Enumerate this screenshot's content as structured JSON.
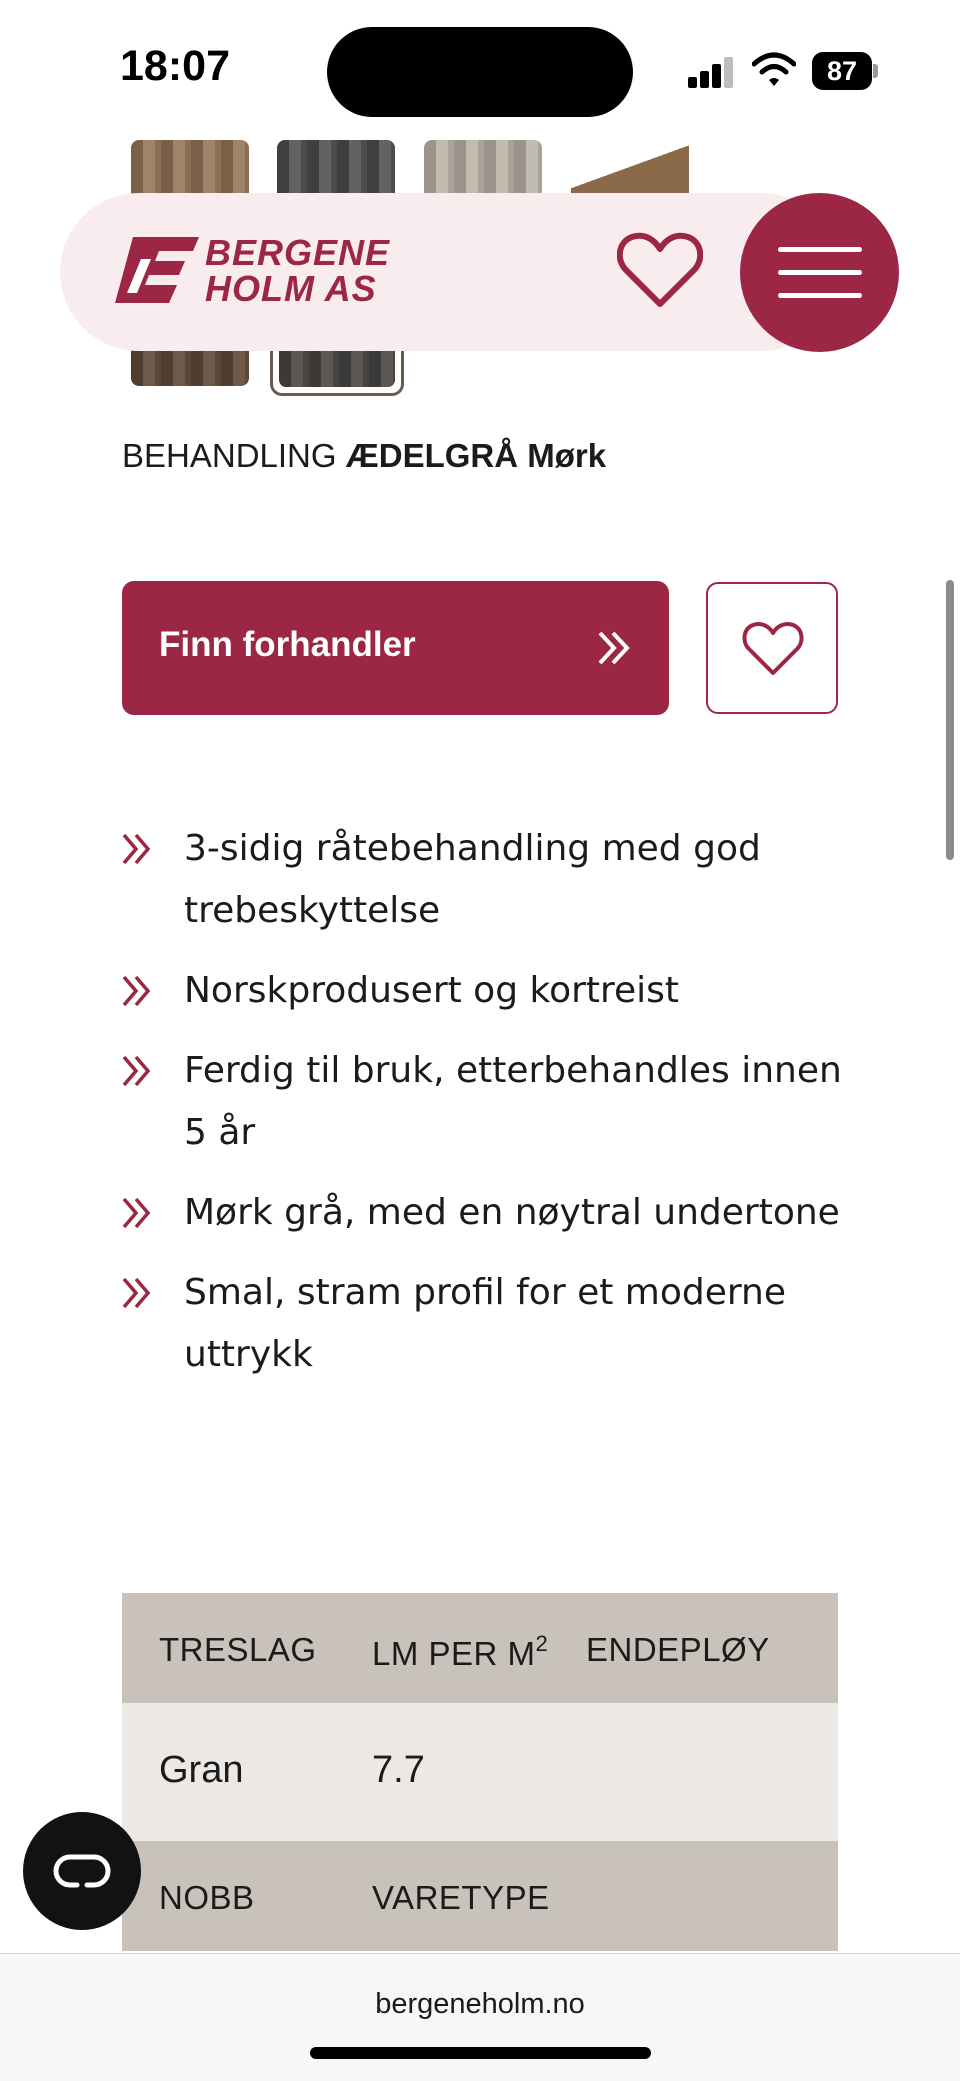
{
  "status_bar": {
    "time": "18:07",
    "battery": "87"
  },
  "header": {
    "logo_line1": "BERGENE",
    "logo_line2": "HOLM AS",
    "brand_color": "#9b2744"
  },
  "product": {
    "treatment_label": "BEHANDLING",
    "treatment_value": "ÆDELGRÅ Mørk"
  },
  "actions": {
    "find_dealer_label": "Finn forhandler"
  },
  "features": [
    "3-sidig råtebehandling med god trebeskyttelse",
    "Norskprodusert og kortreist",
    "Ferdig til bruk, etterbehandles innen 5 år",
    "Mørk grå, med en nøytral undertone",
    "Smal, stram profil for et moderne uttrykk"
  ],
  "specs": {
    "row1_headers": [
      "TRESLAG",
      "LM PER M",
      "ENDEPLØY"
    ],
    "row1_header_sup": "2",
    "row1_values": [
      "Gran",
      "7.7",
      ""
    ],
    "row2_headers": [
      "NOBB",
      "VARETYPE"
    ]
  },
  "browser": {
    "url": "bergeneholm.no"
  }
}
